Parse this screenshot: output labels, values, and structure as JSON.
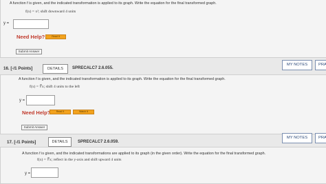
{
  "q15": {
    "prompt": "A function f is given, and the indicated transformation is applied to its graph. Write the equation for the final transformed graph.",
    "equation": "f(x) = x²;  shift downward 4 units",
    "y_label": "y =",
    "answer_value": "",
    "need_help": "Need Help?",
    "read_it": "Read It",
    "submit": "Submit Answer"
  },
  "q16": {
    "number": "16. [-/1 Points]",
    "details": "DETAILS",
    "code": "SPRECALC7 2.6.055.",
    "my_notes": "MY NOTES",
    "practice": "PRACTICE ANOTHER",
    "prompt": "A function f is given, and the indicated transformation is applied to its graph. Write the equation for the final transformed graph.",
    "equation": "f(x) = ∜x;  shift 4 units to the left",
    "y_label": "y =",
    "answer_value": "",
    "need_help": "Need Help?",
    "read_it": "Read It",
    "watch_it": "Watch It",
    "submit": "Submit Answer"
  },
  "q17": {
    "number": "17. [-/1 Points]",
    "details": "DETAILS",
    "code": "SPRECALC7 2.6.059.",
    "my_notes": "MY NOTES",
    "practice": "PRACTICE ANOTHER",
    "prompt": "A function f is given, and the indicated transformations are applied to its graph (in the given order). Write the equation for the final transformed graph.",
    "equation": "f(x) = ∜x;  reflect in the y-axis and shift upward 4 units",
    "y_label": "y =",
    "answer_value": ""
  },
  "colors": {
    "need_help": "#c0392b",
    "button_orange": "#f2a21d",
    "my_notes_text": "#2c4a7a"
  }
}
